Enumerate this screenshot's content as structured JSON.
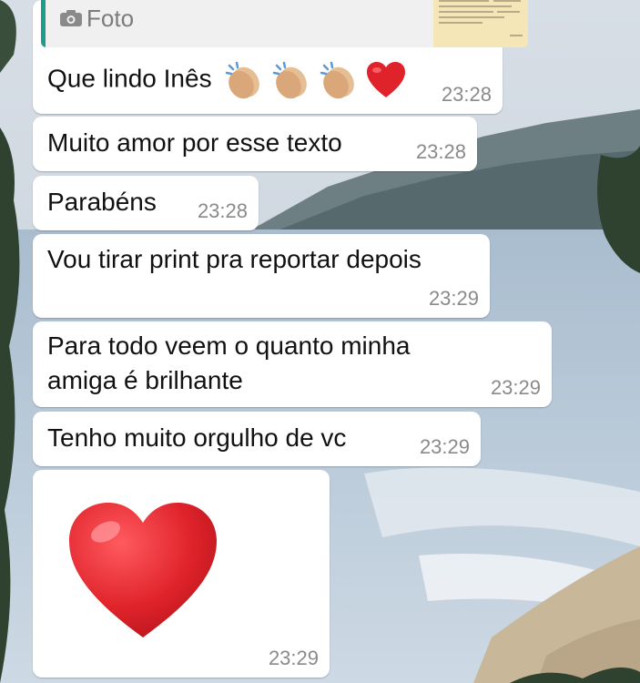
{
  "wallpaper": {
    "sky": "#c9d3dd",
    "hills": "#6e7f84",
    "sea": "#b4c6d6",
    "foam": "#e3e9ef",
    "sand": "#c9b79a",
    "foliage": "#2f4230"
  },
  "colors": {
    "bubble": "#ffffff",
    "text": "#111111",
    "time": "#8a8a8a",
    "quote_accent": "#1e9e8a",
    "heart": "#e0232b"
  },
  "quote": {
    "label": "Foto",
    "icon": "camera-icon"
  },
  "messages": [
    {
      "text": "Que lindo Inês",
      "emojis": [
        "clapping-hands",
        "clapping-hands",
        "clapping-hands",
        "red-heart"
      ],
      "time": "23:28"
    },
    {
      "text": "Muito amor por esse texto",
      "time": "23:28"
    },
    {
      "text": "Parabéns",
      "time": "23:28"
    },
    {
      "text": "Vou tirar print pra reportar depois",
      "time": "23:29"
    },
    {
      "text": "Para todo veem o quanto minha amiga é brilhante",
      "time": "23:29"
    },
    {
      "text": "Tenho muito orgulho de vc",
      "time": "23:29"
    },
    {
      "text": "",
      "emojis": [
        "big-red-heart"
      ],
      "time": "23:29"
    }
  ]
}
